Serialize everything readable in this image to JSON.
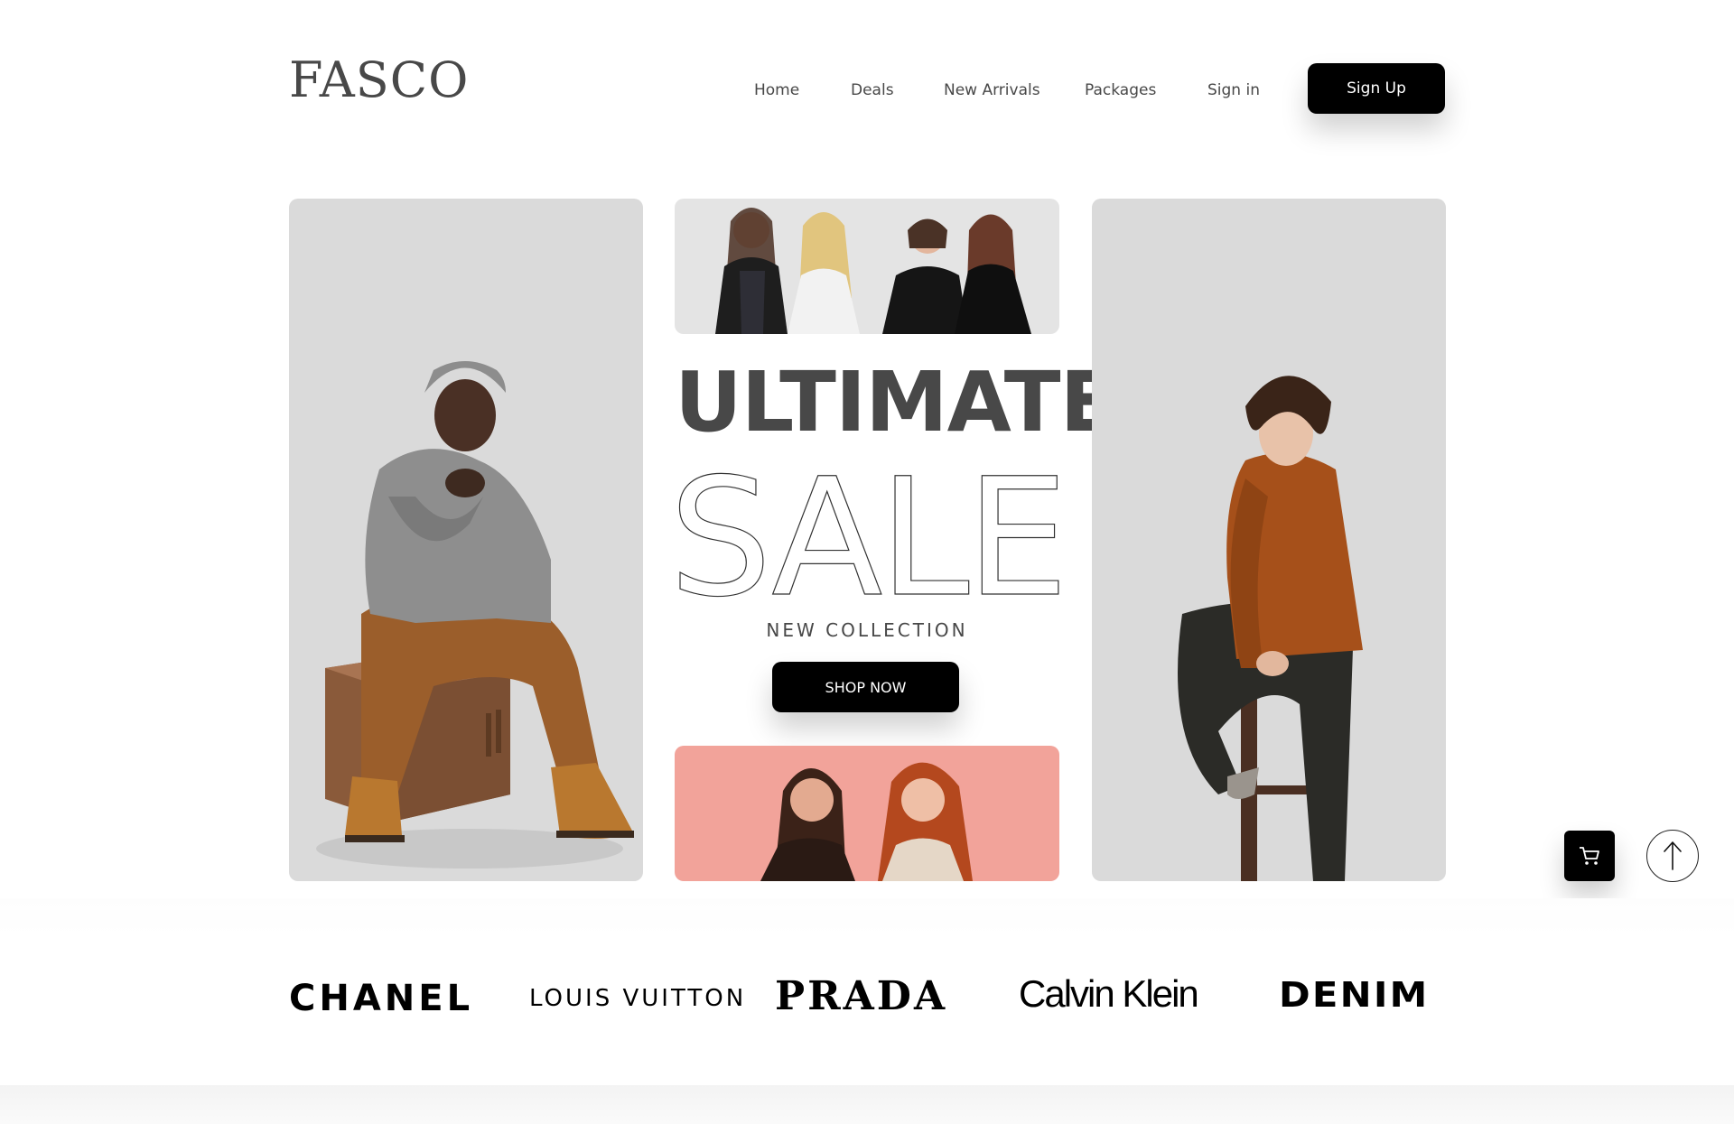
{
  "header": {
    "logo": "FASCO",
    "nav": [
      {
        "label": "Home"
      },
      {
        "label": "Deals"
      },
      {
        "label": "New Arrivals"
      },
      {
        "label": "Packages"
      },
      {
        "label": "Sign in"
      }
    ],
    "signup_label": "Sign Up"
  },
  "hero": {
    "title": "ULTIMATE",
    "title_outline": "SALE",
    "subtitle": "NEW COLLECTION",
    "cta_label": "SHOP NOW"
  },
  "floating": {
    "cart_icon": "cart-icon",
    "up_icon": "arrow-up-icon"
  },
  "brands": [
    "CHANEL",
    "LOUIS VUITTON",
    "PRADA",
    "Calvin Klein",
    "DENIM"
  ],
  "colors": {
    "primary": "#000000",
    "text": "#484848",
    "panel": "#dadada",
    "accent_pink": "#f2a39a",
    "sweater": "#a6501a"
  }
}
